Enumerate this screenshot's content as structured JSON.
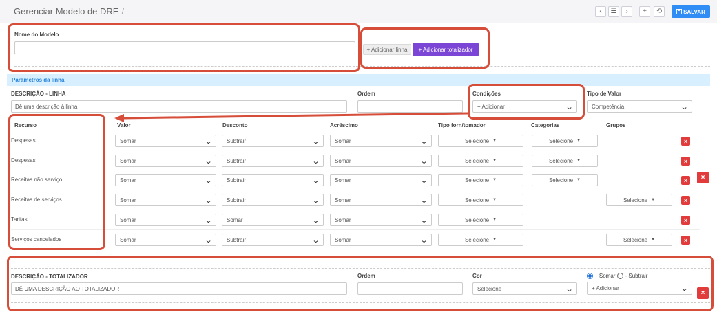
{
  "header": {
    "title": "Gerenciar Modelo de DRE",
    "separator": "/",
    "prev_icon": "‹",
    "list_icon": "☰",
    "next_icon": "›",
    "add_icon": "+",
    "history_icon": "⟲",
    "save_label": "SALVAR"
  },
  "model": {
    "name_label": "Nome do Modelo",
    "name_value": "",
    "add_line_label": "+ Adicionar linha",
    "add_totalizer_label": "+ Adicionar totalizador"
  },
  "params": {
    "section_title": "Parâmetros da linha",
    "description_label": "DESCRIÇÃO - LINHA",
    "description_placeholder": "Dê uma descrição à linha",
    "order_label": "Ordem",
    "order_value": "",
    "conditions_label": "Condições",
    "conditions_value": "+ Adicionar",
    "value_type_label": "Tipo de Valor",
    "value_type_value": "Competência"
  },
  "table": {
    "headers": [
      "Recurso",
      "Valor",
      "Desconto",
      "Acréscimo",
      "Tipo forn/tomador",
      "Categorias",
      "Grupos"
    ],
    "select_placeholder": "Selecione",
    "delete_icon": "×",
    "rows": [
      {
        "recurso": "Despesas",
        "valor": "Somar",
        "desconto": "Subtrair",
        "acrescimo": "Somar",
        "tipo": "Selecione",
        "categorias": "Selecione",
        "grupos": ""
      },
      {
        "recurso": "Despesas",
        "valor": "Somar",
        "desconto": "Subtrair",
        "acrescimo": "Somar",
        "tipo": "Selecione",
        "categorias": "Selecione",
        "grupos": ""
      },
      {
        "recurso": "Receitas não serviço",
        "valor": "Somar",
        "desconto": "Subtrair",
        "acrescimo": "Somar",
        "tipo": "Selecione",
        "categorias": "Selecione",
        "grupos": ""
      },
      {
        "recurso": "Receitas de serviços",
        "valor": "Somar",
        "desconto": "Subtrair",
        "acrescimo": "Somar",
        "tipo": "Selecione",
        "categorias": "",
        "grupos": "Selecione"
      },
      {
        "recurso": "Tarifas",
        "valor": "Somar",
        "desconto": "Somar",
        "acrescimo": "Somar",
        "tipo": "Selecione",
        "categorias": "",
        "grupos": ""
      },
      {
        "recurso": "Serviços cancelados",
        "valor": "Somar",
        "desconto": "Subtrair",
        "acrescimo": "Somar",
        "tipo": "Selecione",
        "categorias": "",
        "grupos": "Selecione"
      }
    ]
  },
  "totalizer": {
    "description_label": "DESCRIÇÃO - TOTALIZADOR",
    "description_placeholder": "DÊ UMA DESCRIÇÃO AO TOTALIZADOR",
    "order_label": "Ordem",
    "order_value": "",
    "color_label": "Cor",
    "color_value": "Selecione",
    "sum_label": "+ Somar",
    "subtract_label": "- Subtrair",
    "add_value": "+ Adicionar"
  },
  "colors": {
    "highlight": "#d64e3a",
    "save": "#2f8df5",
    "purple": "#7b45d6",
    "delete": "#e23b3b",
    "params_bar": "#d8efff"
  }
}
